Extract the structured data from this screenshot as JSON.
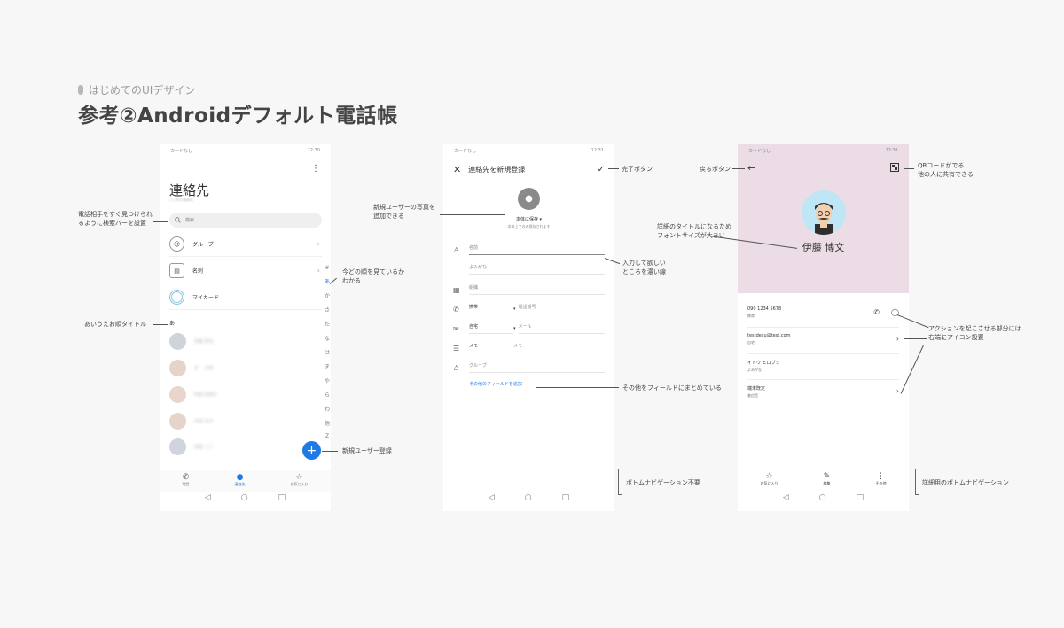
{
  "header": {
    "subtitle": "はじめてのUIデザイン",
    "title": "参考②Androidデフォルト電話帳"
  },
  "phone1": {
    "status_left": "カードなし",
    "status_right": "12:30",
    "kebab": "⋮",
    "title": "連絡先",
    "count": "○○件の連絡先",
    "search_placeholder": "検索",
    "rows": [
      {
        "label": "グループ",
        "icon": "group-icon"
      },
      {
        "label": "名刺",
        "icon": "card-icon"
      },
      {
        "label": "マイカード",
        "icon": "mycard-icon"
      }
    ],
    "section": "あ",
    "index": [
      "#",
      "あ",
      "か",
      "さ",
      "た",
      "な",
      "は",
      "ま",
      "や",
      "ら",
      "わ",
      "他",
      "Z"
    ],
    "contacts": [
      "伊藤 和也",
      "泉 　太郎",
      "阿部 和美子",
      "内田 ゆき",
      "遠藤 ユリ"
    ],
    "contact_colors": [
      "#cfd3da",
      "#e8d3c9",
      "#ead5cd",
      "#e4d4cb",
      "#d0d4dc"
    ],
    "fab": "+",
    "tabs": [
      "電話",
      "連絡先",
      "お気に入り"
    ],
    "accent": "#1e7be5"
  },
  "phone2": {
    "status_left": "カードなし",
    "status_right": "12:31",
    "title": "連絡先を新規登録",
    "save_location": "本体に保存 ▾",
    "save_sub": "本体上でのみ保存されます",
    "fields": {
      "name": "名前",
      "furigana": "よみがな",
      "org": "組織",
      "phone_label": "携帯",
      "phone_ph": "電話番号",
      "email_label": "自宅",
      "email_ph": "メール",
      "memo_label": "メモ",
      "memo_ph": "メモ",
      "group": "グループ"
    },
    "more": "その他のフィールドを追加"
  },
  "phone3": {
    "status_left": "カードなし",
    "status_right": "12:31",
    "name": "伊藤 博文",
    "phone_number": "090 1234 5678",
    "phone_type": "携帯",
    "email": "testdesu@test.com",
    "email_type": "自宅",
    "kana": "イトウ ヒロブミ",
    "kana_label": "よみがな",
    "ringtone": "端末既定",
    "ringtone_label": "着信音",
    "tabs": [
      "お気に入り",
      "編集",
      "その他"
    ],
    "hero_color": "#ebdce5"
  },
  "annotations": {
    "search1": "電話相手をすぐ見つけられ",
    "search2": "るように検索バーを設置",
    "sectiontitle": "あいうえお順タイトル",
    "index1": "今どの順を見ているか",
    "index2": "わかる",
    "newuser": "新規ユーザー登録",
    "photo1": "新規ユーザーの写真を",
    "photo2": "追加できる",
    "done": "完了ボタン",
    "line1": "入力して欲しい",
    "line2": "ところを濃い線",
    "other": "その他をフィールドにまとめている",
    "nobottom": "ボトムナビゲーション不要",
    "back": "戻るボタン",
    "qr1": "QRコードがでる",
    "qr2": "他の人に共有できる",
    "titlefont1": "詳細のタイトルになるため",
    "titlefont2": "フォントサイズが大きい",
    "action1": "アクションを起こさせる部分には",
    "action2": "右端にアイコン設置",
    "detailnav": "詳細用のボトムナビゲーション"
  }
}
